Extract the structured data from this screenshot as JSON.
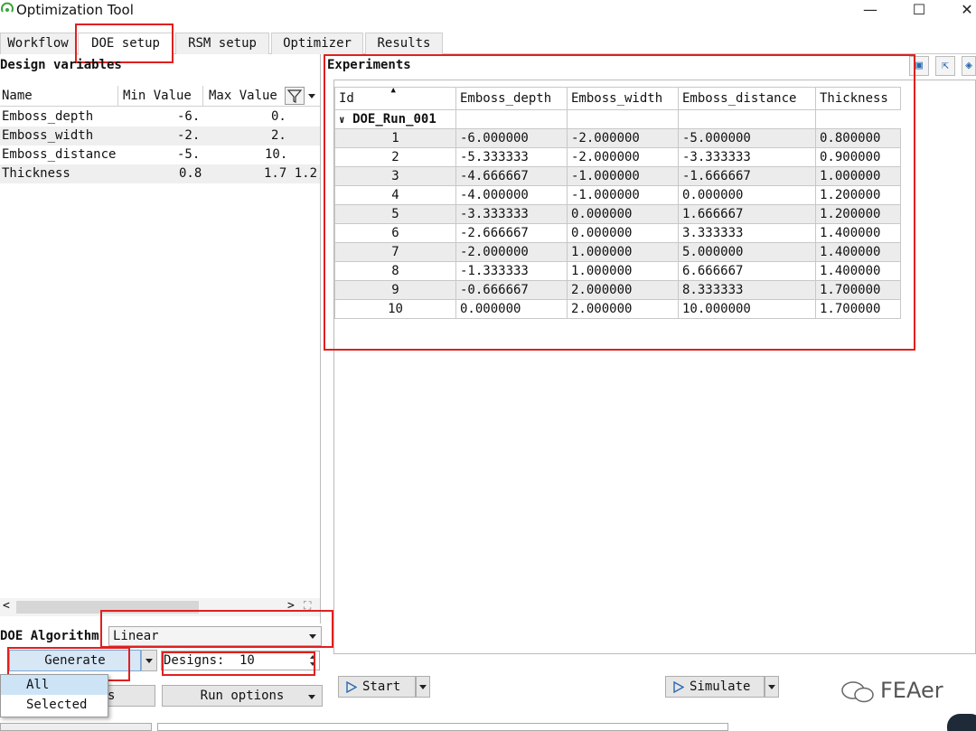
{
  "window": {
    "title": "Optimization Tool",
    "minimize": "—",
    "maximize": "☐",
    "close": "✕"
  },
  "tabs": [
    "Workflow",
    "DOE setup",
    "RSM setup",
    "Optimizer",
    "Results"
  ],
  "design_variables": {
    "title": "Design variables",
    "headers": [
      "Name",
      "Min Value",
      "Max Value"
    ],
    "rows": [
      {
        "name": "Emboss_depth",
        "min": "-6.",
        "max": "0."
      },
      {
        "name": "Emboss_width",
        "min": "-2.",
        "max": "2."
      },
      {
        "name": "Emboss_distance",
        "min": "-5.",
        "max": "10."
      },
      {
        "name": "Thickness",
        "min": "0.8",
        "max": "1.7 1.2,"
      }
    ],
    "scroll_left": "<",
    "scroll_right": ">",
    "scroll_corner": "⛶"
  },
  "doe": {
    "algorithm_label": "DOE Algorithm",
    "algorithm_value": "Linear",
    "generate_label": "Generate",
    "designs_label": "Designs:",
    "designs_value": "10",
    "dropdown": [
      "All",
      "Selected"
    ],
    "hidden_button_suffix": "s",
    "run_options_label": "Run options"
  },
  "experiments": {
    "title": "Experiments",
    "headers": [
      "Id",
      "Emboss_depth",
      "Emboss_width",
      "Emboss_distance",
      "Thickness"
    ],
    "group": "DOE_Run_001",
    "rows": [
      [
        "1",
        "-6.000000",
        "-2.000000",
        "-5.000000",
        "0.800000"
      ],
      [
        "2",
        "-5.333333",
        "-2.000000",
        "-3.333333",
        "0.900000"
      ],
      [
        "3",
        "-4.666667",
        "-1.000000",
        "-1.666667",
        "1.000000"
      ],
      [
        "4",
        "-4.000000",
        "-1.000000",
        "0.000000",
        "1.200000"
      ],
      [
        "5",
        "-3.333333",
        "0.000000",
        "1.666667",
        "1.200000"
      ],
      [
        "6",
        "-2.666667",
        "0.000000",
        "3.333333",
        "1.400000"
      ],
      [
        "7",
        "-2.000000",
        "1.000000",
        "5.000000",
        "1.400000"
      ],
      [
        "8",
        "-1.333333",
        "1.000000",
        "6.666667",
        "1.400000"
      ],
      [
        "9",
        "-0.666667",
        "2.000000",
        "8.333333",
        "1.700000"
      ],
      [
        "10",
        "0.000000",
        "2.000000",
        "10.000000",
        "1.700000"
      ]
    ]
  },
  "actions": {
    "start_label": "Start",
    "simulate_label": "Simulate"
  },
  "watermark": "FEAer",
  "colors": {
    "highlight": "#e0201e",
    "selected_row": "#cde4f7"
  }
}
